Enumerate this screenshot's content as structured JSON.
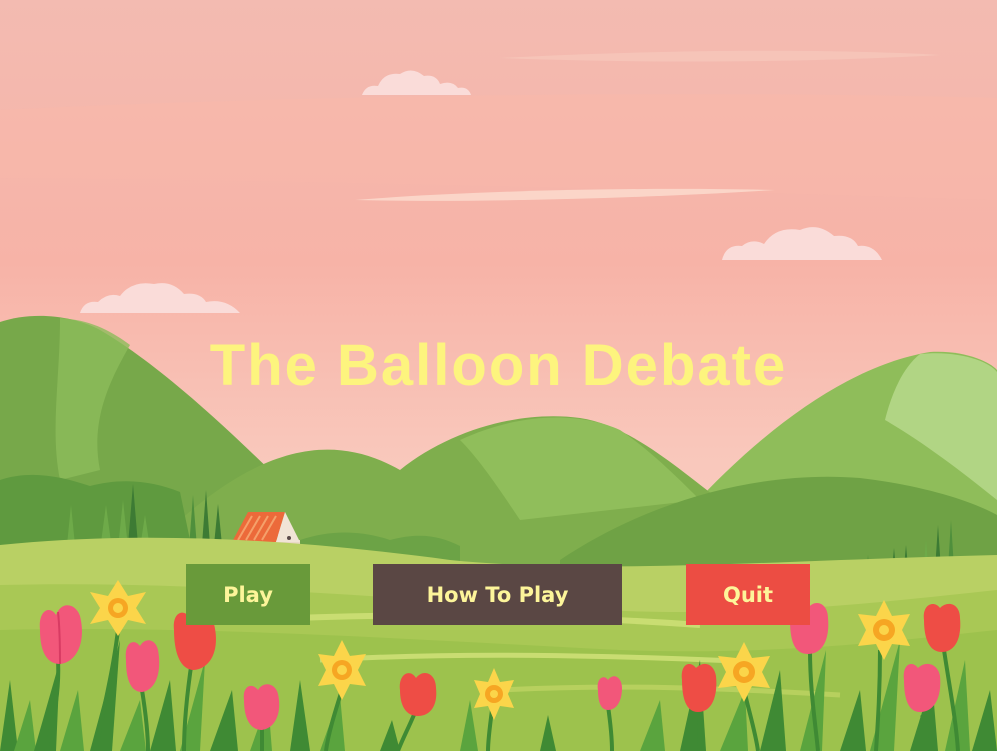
{
  "game": {
    "title": "The Balloon Debate"
  },
  "menu": {
    "play_label": "Play",
    "how_to_play_label": "How To Play",
    "quit_label": "Quit"
  },
  "colors": {
    "title_text": "#fdf47e",
    "button_text": "#fdf59a",
    "play_button": "#699a3a",
    "how_to_play_button": "#5a4744",
    "quit_button": "#ec4d43",
    "sky_top": "#f3bdb3",
    "sky_bottom": "#f7cdbf"
  }
}
